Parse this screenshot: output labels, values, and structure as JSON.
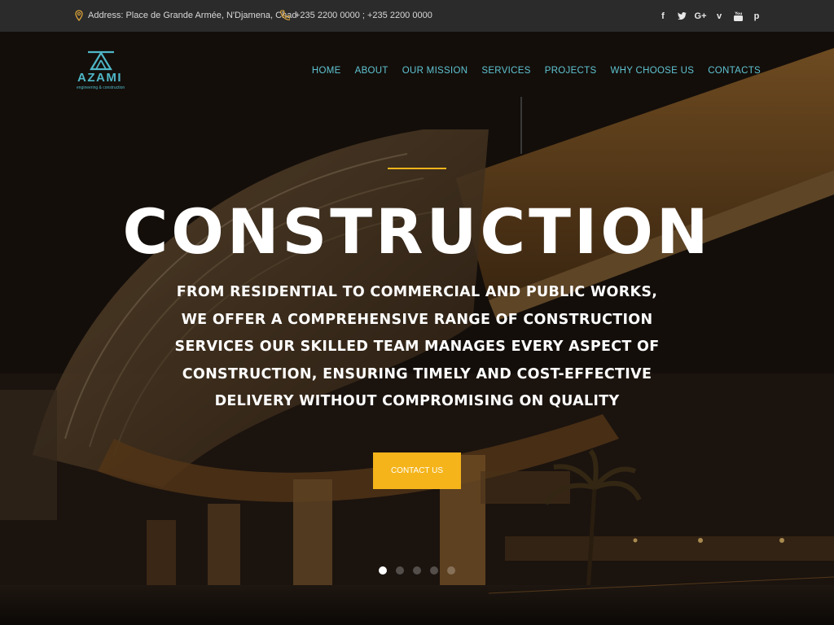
{
  "topbar": {
    "address": "Address: Place de Grande Armée, N'Djamena, Chad",
    "phone": "+235 2200 0000 ; +235 2200 0000",
    "socials": [
      {
        "name": "facebook-icon",
        "glyph": "f"
      },
      {
        "name": "twitter-icon",
        "glyph": "🐦"
      },
      {
        "name": "google-plus-icon",
        "glyph": "G+"
      },
      {
        "name": "vimeo-icon",
        "glyph": "v"
      },
      {
        "name": "youtube-icon",
        "glyph": "▶"
      },
      {
        "name": "pinterest-icon",
        "glyph": "p"
      }
    ]
  },
  "brand": {
    "name": "AZAMI",
    "tagline": "engineering & construction",
    "color": "#4fb7c7"
  },
  "nav": {
    "items": [
      "HOME",
      "ABOUT",
      "OUR MISSION",
      "SERVICES",
      "PROJECTS",
      "WHY CHOOSE US",
      "CONTACTS"
    ]
  },
  "hero": {
    "title": "CONSTRUCTION",
    "subtitle": "FROM RESIDENTIAL TO COMMERCIAL AND PUBLIC WORKS, WE OFFER A COMPREHENSIVE RANGE OF CONSTRUCTION SERVICES OUR SKILLED TEAM MANAGES EVERY ASPECT OF CONSTRUCTION, ENSURING TIMELY AND COST-EFFECTIVE DELIVERY WITHOUT COMPROMISING ON QUALITY",
    "cta_label": "CONTACT US",
    "accent_color": "#f4b41a",
    "slides": 5,
    "active_slide": 1
  }
}
